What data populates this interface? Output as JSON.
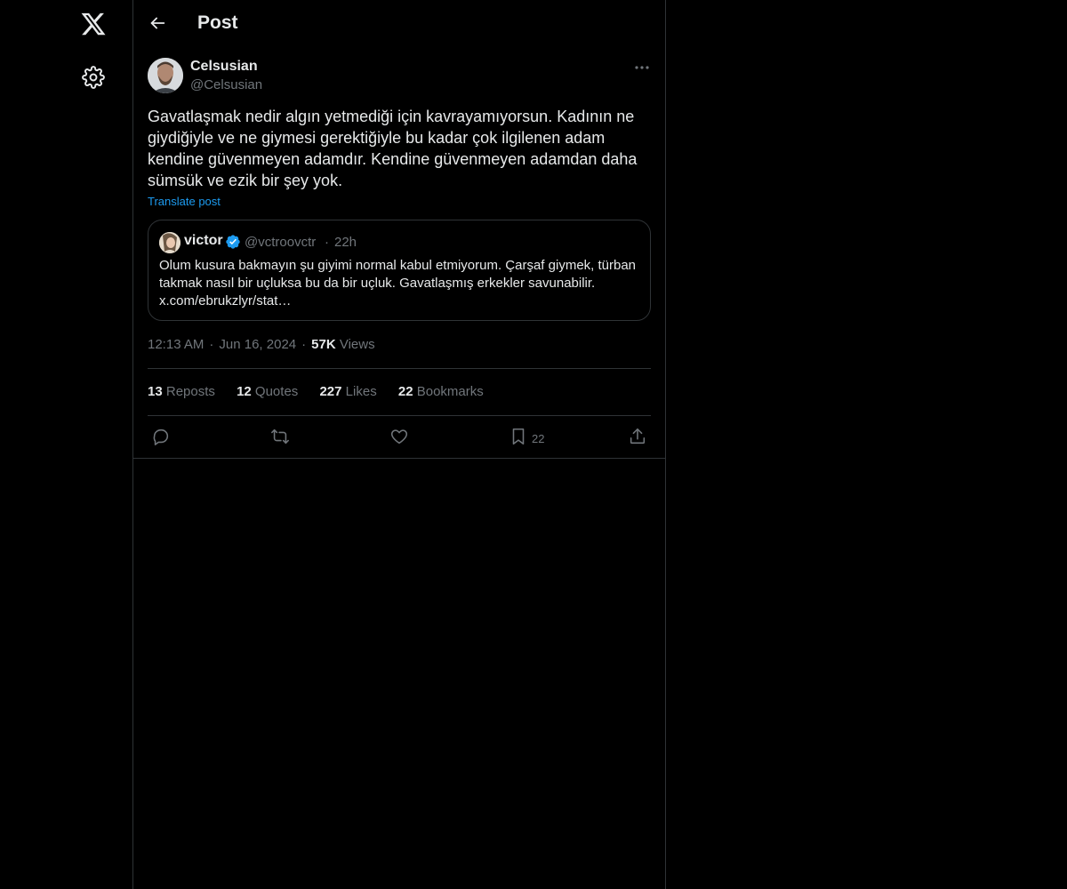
{
  "sidebar": {
    "logo_icon": "x-logo-icon",
    "settings_icon": "gear-icon"
  },
  "header": {
    "back_icon": "arrow-left-icon",
    "title": "Post"
  },
  "post": {
    "author_name": "Celsusian",
    "author_handle": "@Celsusian",
    "more_icon": "ellipsis-icon",
    "text": "Gavatlaşmak nedir algın yetmediği için kavrayamıyorsun. Kadının ne giydiğiyle ve ne giymesi gerektiğiyle bu kadar çok ilgilenen adam kendine güvenmeyen adamdır. Kendine güvenmeyen adamdan daha sümsük ve ezik bir şey yok.",
    "translate_label": "Translate post",
    "time": "12:13 AM",
    "date": "Jun 16, 2024",
    "separator": "·",
    "views_count": "57K",
    "views_label": "Views"
  },
  "quote": {
    "name": "victor",
    "verified_icon": "verified-badge-icon",
    "handle": "@vctroovctr",
    "separator": "·",
    "time": "22h",
    "text": "Olum kusura bakmayın şu giyimi normal kabul etmiyorum. Çarşaf giymek, türban takmak nasıl bir uçluksa bu da bir uçluk. Gavatlaşmış erkekler savunabilir. x.com/ebrukzlyr/stat…"
  },
  "stats": {
    "reposts_count": "13",
    "reposts_label": "Reposts",
    "quotes_count": "12",
    "quotes_label": "Quotes",
    "likes_count": "227",
    "likes_label": "Likes",
    "bookmarks_count": "22",
    "bookmarks_label": "Bookmarks"
  },
  "actions": {
    "reply_icon": "reply-icon",
    "repost_icon": "repost-icon",
    "like_icon": "heart-icon",
    "bookmark_icon": "bookmark-icon",
    "bookmark_count": "22",
    "share_icon": "share-icon"
  },
  "colors": {
    "background": "#000000",
    "text_primary": "#e7e9ea",
    "text_secondary": "#71767b",
    "border": "#2f3336",
    "accent": "#1d9bf0"
  }
}
